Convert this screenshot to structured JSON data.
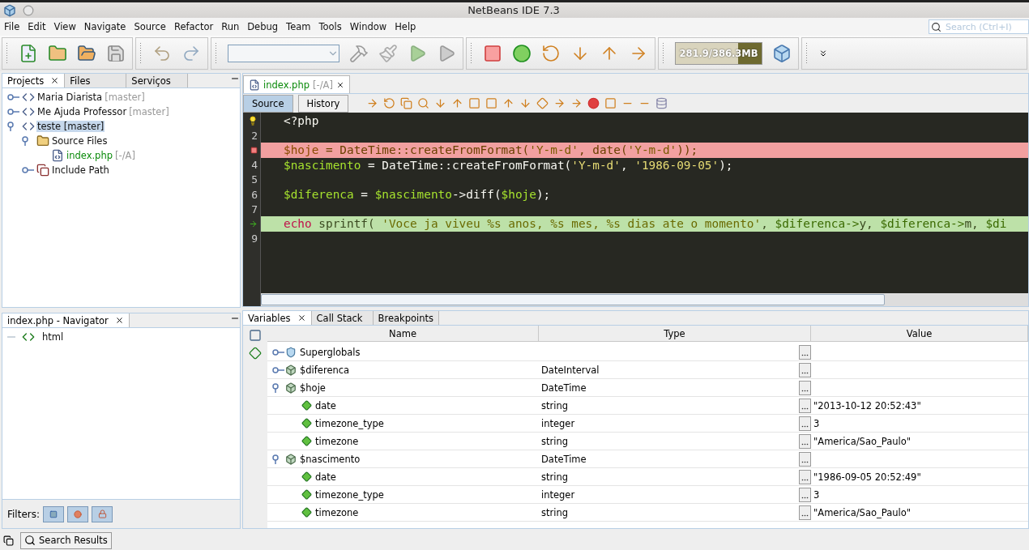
{
  "window": {
    "title": "NetBeans IDE 7.3"
  },
  "menu": [
    "File",
    "Edit",
    "View",
    "Navigate",
    "Source",
    "Refactor",
    "Run",
    "Debug",
    "Team",
    "Tools",
    "Window",
    "Help"
  ],
  "search": {
    "placeholder": "Search (Ctrl+I)"
  },
  "memory": {
    "reading": "281.9/386.3MB",
    "level": 0.73
  },
  "projects_panel": {
    "tabs": [
      {
        "label": "Projects",
        "selected": true
      },
      {
        "label": "Files",
        "selected": false
      },
      {
        "label": "Serviços",
        "selected": false
      }
    ],
    "tree": [
      {
        "name": "Maria Diarista",
        "suffix": "[master]",
        "selected": false,
        "expanded": false,
        "kind": "project"
      },
      {
        "name": "Me Ajuda Professor",
        "suffix": "[master]",
        "selected": false,
        "expanded": false,
        "kind": "project"
      },
      {
        "name": "teste [master]",
        "selected": true,
        "expanded": true,
        "kind": "project",
        "children": [
          {
            "name": "Source Files",
            "selected": false,
            "expanded": true,
            "kind": "folder",
            "children": [
              {
                "name": "index.php",
                "suffix": "[-/A]",
                "selected": false,
                "kind": "file"
              }
            ]
          },
          {
            "name": "Include Path",
            "selected": false,
            "expanded": false,
            "kind": "library"
          }
        ]
      }
    ]
  },
  "navigator": {
    "title": "index.php - Navigator",
    "items": [
      {
        "name": "html"
      }
    ],
    "filters_label": "Filters:"
  },
  "status_bar": {
    "button": "Search Results"
  },
  "editor": {
    "tab": {
      "name": "index.php",
      "suffix": "[-/A]"
    },
    "views": [
      {
        "label": "Source",
        "selected": true
      },
      {
        "label": "History",
        "selected": false
      }
    ],
    "lines": [
      {
        "hint": true,
        "tokens": [
          {
            "kind": "plain",
            "text": "<?php"
          }
        ]
      },
      {
        "number": "2"
      },
      {
        "breakpoint": true,
        "tokens": [
          {
            "kind": "var",
            "text": "$hoje"
          },
          {
            "kind": "plain",
            "text": " = "
          },
          {
            "kind": "plain",
            "text": "DateTime::createFromFormat("
          },
          {
            "kind": "string",
            "text": "'Y-m-d'"
          },
          {
            "kind": "plain",
            "text": ", date("
          },
          {
            "kind": "string",
            "text": "'Y-m-d'"
          },
          {
            "kind": "plain",
            "text": "));"
          }
        ]
      },
      {
        "number": "4",
        "tokens": [
          {
            "kind": "var",
            "text": "$nascimento"
          },
          {
            "kind": "plain",
            "text": " = DateTime::createFromFormat("
          },
          {
            "kind": "string",
            "text": "'Y-m-d'"
          },
          {
            "kind": "plain",
            "text": ", "
          },
          {
            "kind": "string",
            "text": "'1986-09-05'"
          },
          {
            "kind": "plain",
            "text": ");"
          }
        ]
      },
      {
        "number": "5"
      },
      {
        "number": "6",
        "tokens": [
          {
            "kind": "var",
            "text": "$diferenca"
          },
          {
            "kind": "plain",
            "text": " = "
          },
          {
            "kind": "var",
            "text": "$nascimento"
          },
          {
            "kind": "plain",
            "text": "->diff("
          },
          {
            "kind": "var",
            "text": "$hoje"
          },
          {
            "kind": "plain",
            "text": ");"
          }
        ]
      },
      {
        "number": "7"
      },
      {
        "current": true,
        "tokens": [
          {
            "kind": "keyword",
            "text": "echo"
          },
          {
            "kind": "plain",
            "text": " sprintf( "
          },
          {
            "kind": "string",
            "text": "'Voce ja viveu %s anos, %s mes, %s dias ate o momento'"
          },
          {
            "kind": "plain",
            "text": ", "
          },
          {
            "kind": "var",
            "text": "$diferenca->"
          },
          {
            "kind": "plain",
            "text": "y, "
          },
          {
            "kind": "var",
            "text": "$diferenca->"
          },
          {
            "kind": "plain",
            "text": "m, "
          },
          {
            "kind": "var",
            "text": "$di"
          }
        ]
      },
      {
        "number": "9"
      }
    ]
  },
  "debugger": {
    "tabs": [
      {
        "label": "Variables",
        "selected": true
      },
      {
        "label": "Call Stack",
        "selected": false
      },
      {
        "label": "Breakpoints",
        "selected": false
      }
    ],
    "columns": [
      "Name",
      "Type",
      "Value"
    ],
    "rows": [
      {
        "name": "Superglobals",
        "kind": "group",
        "expanded": false
      },
      {
        "name": "$diferenca",
        "type": "DateInterval",
        "kind": "object",
        "expanded": false
      },
      {
        "name": "$hoje",
        "type": "DateTime",
        "kind": "object",
        "expanded": true,
        "children": [
          {
            "name": "date",
            "type": "string",
            "value": "\"2013-10-12 20:52:43\"",
            "kind": "field"
          },
          {
            "name": "timezone_type",
            "type": "integer",
            "value": "3",
            "kind": "field"
          },
          {
            "name": "timezone",
            "type": "string",
            "value": "\"America/Sao_Paulo\"",
            "kind": "field"
          }
        ]
      },
      {
        "name": "$nascimento",
        "type": "DateTime",
        "kind": "object",
        "expanded": true,
        "children": [
          {
            "name": "date",
            "type": "string",
            "value": "\"1986-09-05 20:52:49\"",
            "kind": "field"
          },
          {
            "name": "timezone_type",
            "type": "integer",
            "value": "3",
            "kind": "field"
          },
          {
            "name": "timezone",
            "type": "string",
            "value": "\"America/Sao_Paulo\"",
            "kind": "field"
          }
        ]
      }
    ]
  }
}
